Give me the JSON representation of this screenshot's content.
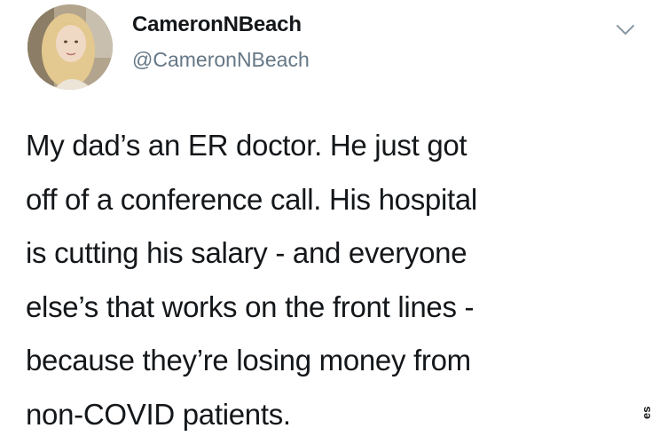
{
  "tweet": {
    "display_name": "CameronNBeach",
    "handle": "@CameronNBeach",
    "text_lines": [
      "My dad’s an ER doctor. He just got",
      "off of a conference call. His hospital",
      "is cutting his salary - and everyone",
      "else’s that works on the front lines -",
      "because they’re losing money from",
      "non-COVID patients."
    ]
  },
  "icons": {
    "avatar": "profile-photo",
    "menu": "chevron-down-icon"
  },
  "edge_text": "es",
  "colors": {
    "name": "#14171a",
    "handle": "#657786",
    "chevron": "#8899a6",
    "background": "#ffffff"
  }
}
